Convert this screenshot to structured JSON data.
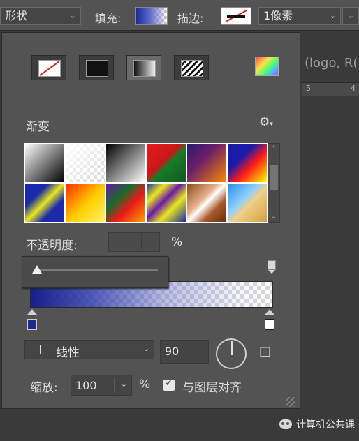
{
  "toolbar": {
    "shape_mode": "形状",
    "fill_label": "填充:",
    "stroke_label": "描边:",
    "stroke_width": "1像素"
  },
  "background": {
    "doc_text": "(logo, R(",
    "ruler_marks": [
      "5",
      "4"
    ]
  },
  "panel": {
    "fill_types": [
      {
        "name": "none",
        "icon": "no-fill-icon"
      },
      {
        "name": "solid",
        "icon": "solid-color-icon"
      },
      {
        "name": "gradient",
        "icon": "gradient-icon"
      },
      {
        "name": "pattern",
        "icon": "pattern-icon"
      }
    ],
    "active_fill_type": "gradient",
    "section_title": "渐变",
    "gear_label": "⚙",
    "presets": [
      "linear-gradient(135deg, #ffffff 0%, #000000 100%)",
      "white-to-transparent",
      "linear-gradient(135deg, #000000 0%, #ffffff 100%)",
      "linear-gradient(135deg, #e81c1c 0%, #c81818 45%, #1a7a2a 55%, #0e5a1e 100%)",
      "linear-gradient(135deg, #2a1a6e 0%, #6a1e6a 40%, #ff8a00 100%)",
      "linear-gradient(135deg, #1a1aa8 0%, #1a1aa8 35%, #ff1a1a 60%, #ffff00 100%)",
      "linear-gradient(135deg, #1a2aa8 0%, #1a2aa8 30%, #e8e81a 50%, #1a2aa8 70%, #1a2aa8 100%)",
      "linear-gradient(135deg, #ff2a00 0%, #ffd000 55%, #fff06a 100%)",
      "linear-gradient(135deg, #6a1aa8 0%, #1a6a2a 35%, #e81a1a 60%, #ffa000 100%)",
      "linear-gradient(135deg, #1a2aa8 0%, #e8e81a 25%, #6a1aa8 45%, #e8e81a 65%, #1a2aa8 100%)",
      "linear-gradient(135deg, #8a4a1a 0%, #e8b08a 40%, #ffffff 50%, #a85a2a 70%, #6a2a0a 100%)",
      "linear-gradient(135deg, #2a8ae8 0%, #8ad0ff 40%, #f0d08a 55%, #d0a040 100%)"
    ],
    "opacity_label": "不透明度:",
    "percent_sign": "%",
    "gradient_colors": {
      "start": "#161f8c",
      "end": "#ffffff"
    },
    "stop_colors": {
      "left": "#1f2a8f",
      "right": "#ffffff"
    },
    "style_label": "线性",
    "angle_value": "90",
    "scale_label": "缩放:",
    "scale_value": "100",
    "align_label": "与图层对齐",
    "align_checked": true
  },
  "watermark": {
    "text": "计算机公共课"
  }
}
